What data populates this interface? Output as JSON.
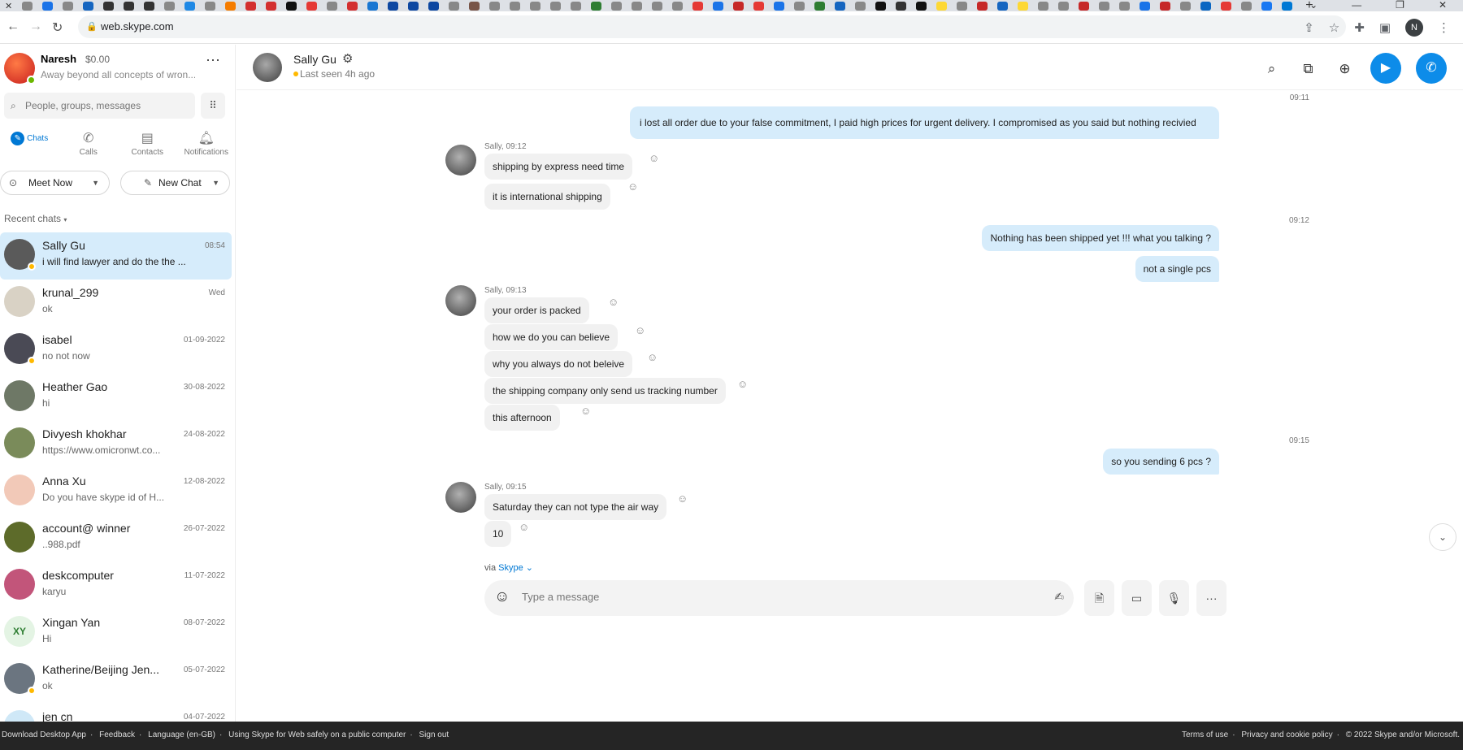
{
  "browser": {
    "url": "web.skype.com",
    "profile_initial": "N",
    "favicon_colors": [
      "#888888",
      "#1a73e8",
      "#888888",
      "#1565c0",
      "#333333",
      "#333333",
      "#333333",
      "#888888",
      "#1e88e5",
      "#888888",
      "#f57c00",
      "#d32f2f",
      "#d32f2f",
      "#111111",
      "#e53935",
      "#888888",
      "#d32f2f",
      "#1976d2",
      "#0d47a1",
      "#0d47a1",
      "#0d47a1",
      "#888888",
      "#795548",
      "#888888",
      "#888888",
      "#888888",
      "#888888",
      "#888888",
      "#2e7d32",
      "#888888",
      "#888888",
      "#888888",
      "#888888",
      "#e53935",
      "#1a73e8",
      "#c62828",
      "#e53935",
      "#1a73e8",
      "#888888",
      "#2e7d32",
      "#1565c0",
      "#888888",
      "#111111",
      "#333333",
      "#111111",
      "#fdd835",
      "#888888",
      "#c62828",
      "#1565c0",
      "#fdd835",
      "#888888",
      "#888888",
      "#c62828",
      "#888888",
      "#888888",
      "#1a73e8",
      "#c62828",
      "#888888",
      "#0a66c2",
      "#e53935",
      "#888888",
      "#1877f2",
      "#0078d4"
    ]
  },
  "profile": {
    "name": "Naresh",
    "credit": "$0.00",
    "status": "Away beyond all concepts of wron..."
  },
  "search": {
    "placeholder": "People, groups, messages"
  },
  "nav": {
    "tabs": [
      {
        "label": "Chats",
        "icon": "chat-icon"
      },
      {
        "label": "Calls",
        "icon": "phone-icon"
      },
      {
        "label": "Contacts",
        "icon": "contacts-icon"
      },
      {
        "label": "Notifications",
        "icon": "bell-icon"
      }
    ]
  },
  "actions": {
    "meet_now": "Meet Now",
    "new_chat": "New Chat"
  },
  "recent_label": "Recent chats",
  "chats": [
    {
      "name": "Sally Gu",
      "last": "i will find lawyer and do the the ...",
      "date": "08:54",
      "color": "#5a5a5a"
    },
    {
      "name": "krunal_299",
      "last": "ok",
      "date": "Wed",
      "color": "#d9d2c5"
    },
    {
      "name": "isabel",
      "last": "no not now",
      "date": "01-09-2022",
      "color": "#4a4a55"
    },
    {
      "name": "Heather Gao",
      "last": "hi",
      "date": "30-08-2022",
      "color": "#6e7866"
    },
    {
      "name": "Divyesh khokhar",
      "last": "https://www.omicronwt.co...",
      "date": "24-08-2022",
      "color": "#7a8b5a"
    },
    {
      "name": "Anna Xu",
      "last": "Do you have skype id of H...",
      "date": "12-08-2022",
      "color": "#f2c9b8"
    },
    {
      "name": "account@ winner",
      "last": "..988.pdf",
      "date": "26-07-2022",
      "color": "#5d6b2a"
    },
    {
      "name": "deskcomputer",
      "last": "karyu",
      "date": "11-07-2022",
      "color": "#c2557a"
    },
    {
      "name": "Xingan  Yan",
      "last": "Hi",
      "date": "08-07-2022",
      "initials": "XY",
      "color": "#e4f4e4"
    },
    {
      "name": "Katherine/Beijing Jen...",
      "last": "ok",
      "date": "05-07-2022",
      "color": "#6b7580"
    },
    {
      "name": "jen cn",
      "last": "",
      "date": "04-07-2022",
      "color": "#cfe8f7"
    }
  ],
  "conversation": {
    "contact_name": "Sally Gu",
    "last_seen": "Last seen 4h ago",
    "via_label": "via",
    "via_app": "Skype",
    "input_placeholder": "Type a message",
    "out_groups": [
      {
        "time": "09:11",
        "messages": [
          "i lost all order due to your false commitment, I paid high prices for urgent delivery. I compromised as you said but nothing recivied"
        ]
      },
      {
        "time": "09:12",
        "messages": [
          "Nothing has been shipped yet !!! what you talking ?",
          "not a single pcs"
        ]
      },
      {
        "time": "09:15",
        "messages": [
          "so you sending 6 pcs ?"
        ]
      }
    ],
    "in_groups": [
      {
        "header": "Sally, 09:12",
        "messages": [
          "shipping by express need time",
          "it is international shipping"
        ]
      },
      {
        "header": "Sally, 09:13",
        "messages": [
          "your order is packed",
          "how we do you can believe",
          "why you always do not beleive",
          "the shipping company only send us tracking number",
          "this afternoon"
        ]
      },
      {
        "header": "Sally, 09:15",
        "messages": [
          "Saturday they can not type the air way",
          "10"
        ]
      }
    ]
  },
  "footer": {
    "left": [
      "Download Desktop App",
      "Feedback",
      "Language (en-GB)",
      "Using Skype for Web safely on a public computer",
      "Sign out"
    ],
    "right": [
      "Terms of use",
      "Privacy and cookie policy",
      "© 2022 Skype and/or Microsoft."
    ]
  }
}
